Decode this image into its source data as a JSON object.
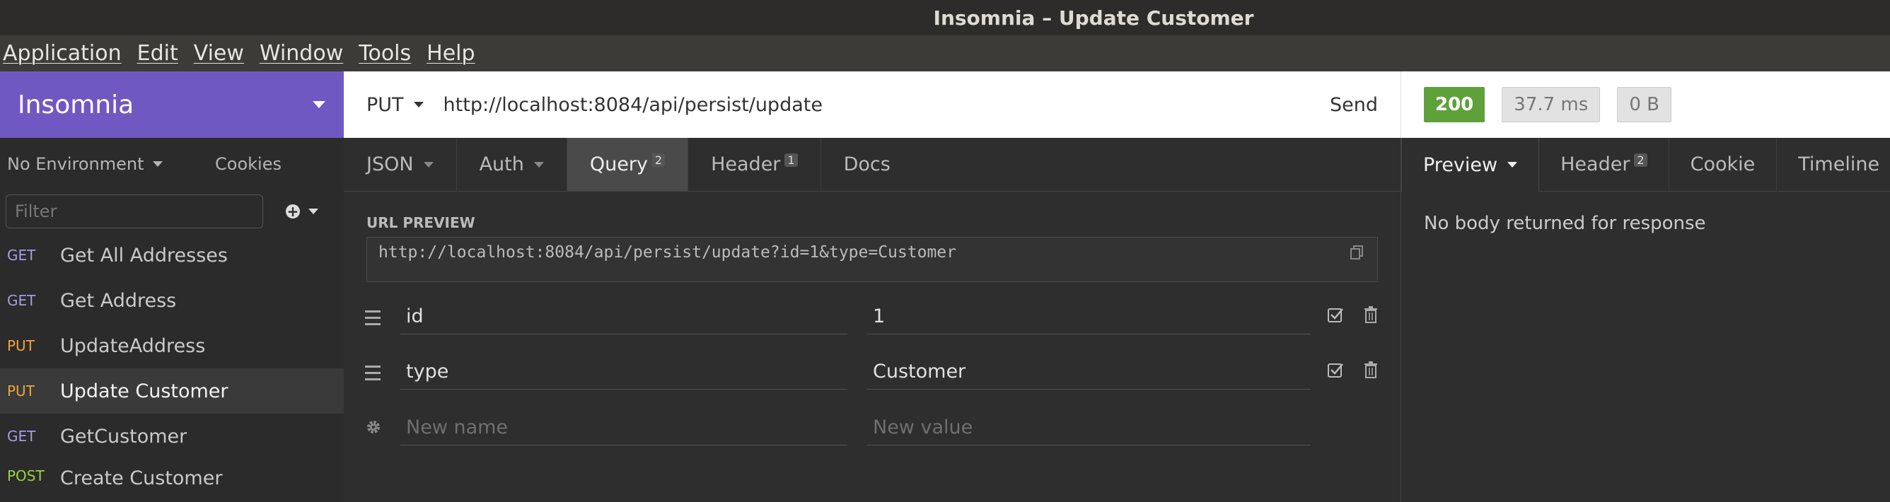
{
  "window": {
    "title": "Insomnia – Update Customer"
  },
  "menu": [
    "Application",
    "Edit",
    "View",
    "Window",
    "Tools",
    "Help"
  ],
  "sidebar": {
    "workspace": "Insomnia",
    "environment": "No Environment",
    "cookies": "Cookies",
    "filter_placeholder": "Filter",
    "requests": [
      {
        "method": "GET",
        "name": "Get All Addresses"
      },
      {
        "method": "GET",
        "name": "Get Address"
      },
      {
        "method": "PUT",
        "name": "UpdateAddress"
      },
      {
        "method": "PUT",
        "name": "Update Customer",
        "active": true
      },
      {
        "method": "GET",
        "name": "GetCustomer"
      },
      {
        "method": "POST",
        "name": "Create Customer"
      }
    ]
  },
  "request": {
    "method": "PUT",
    "url": "http://localhost:8084/api/persist/update",
    "send": "Send",
    "tabs": [
      {
        "label": "JSON",
        "dropdown": true
      },
      {
        "label": "Auth",
        "dropdown": true
      },
      {
        "label": "Query",
        "count": "2",
        "active": true
      },
      {
        "label": "Header",
        "count": "1"
      },
      {
        "label": "Docs"
      }
    ],
    "url_preview_label": "URL PREVIEW",
    "url_preview": "http://localhost:8084/api/persist/update?id=1&type=Customer",
    "params": [
      {
        "name": "id",
        "value": "1"
      },
      {
        "name": "type",
        "value": "Customer"
      }
    ],
    "new_name_placeholder": "New name",
    "new_value_placeholder": "New value"
  },
  "response": {
    "status": "200",
    "time": "37.7 ms",
    "size": "0 B",
    "tabs": [
      {
        "label": "Preview",
        "active": true,
        "dropdown": true
      },
      {
        "label": "Header",
        "count": "2"
      },
      {
        "label": "Cookie"
      },
      {
        "label": "Timeline"
      }
    ],
    "body": "No body returned for response"
  },
  "colors": {
    "accent": "#7058c2",
    "status_ok": "#5ea13a",
    "get": "#a49ce6",
    "put": "#f0a53a",
    "post": "#9ad13d"
  }
}
